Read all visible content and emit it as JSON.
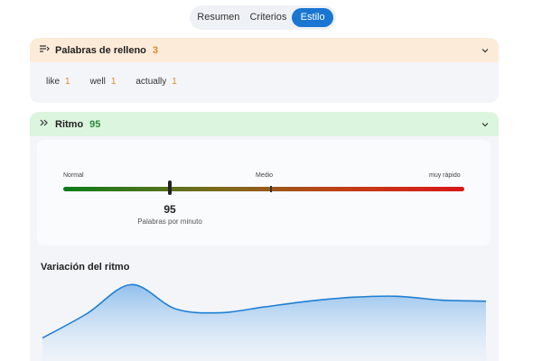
{
  "tabs": [
    {
      "label": "Resumen",
      "active": false
    },
    {
      "label": "Criterios",
      "active": false
    },
    {
      "label": "Estilo",
      "active": true
    }
  ],
  "filler": {
    "icon": "list-lines-icon",
    "title": "Palabras de relleno",
    "count": "3",
    "words": [
      {
        "word": "like",
        "count": "1"
      },
      {
        "word": "well",
        "count": "1"
      },
      {
        "word": "actually",
        "count": "1"
      }
    ]
  },
  "rhythm": {
    "icon": "double-chevron-right-icon",
    "title": "Ritmo",
    "score": "95",
    "scale": {
      "low": "Normal",
      "mid": "Medio",
      "high": "muy rápido"
    },
    "value": "95",
    "unit": "Palabras por minuto",
    "variation_title": "Variación del ritmo"
  },
  "colors": {
    "accent": "#1976d2",
    "filler_header": "#fdebd9",
    "filler_count": "#d98a2b",
    "rhythm_header": "#dcf5df",
    "rhythm_score": "#2e8b3a",
    "line": "#1f7fd4"
  },
  "chart_data": {
    "type": "area",
    "y": [
      20,
      45,
      75,
      50,
      46,
      52,
      58,
      62,
      63,
      59,
      58
    ]
  }
}
